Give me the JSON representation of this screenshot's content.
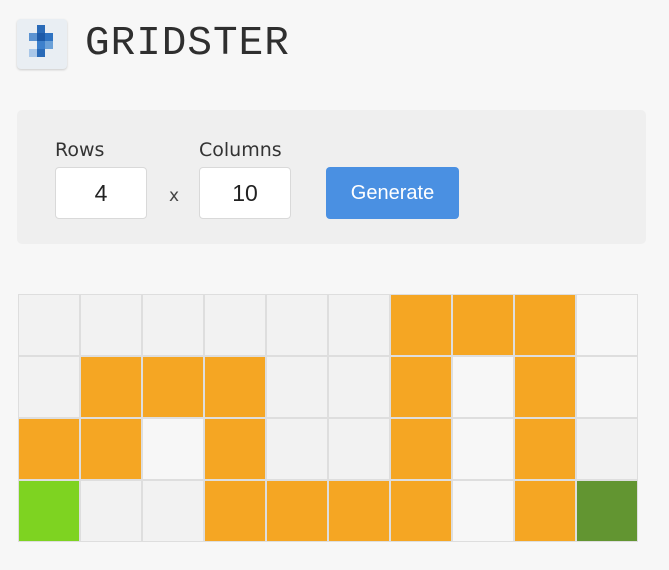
{
  "app": {
    "title": "GRIDSTER",
    "logo_icon": "tetromino-blocks-icon"
  },
  "controls": {
    "rows_label": "Rows",
    "rows_value": "4",
    "times_symbol": "x",
    "columns_label": "Columns",
    "columns_value": "10",
    "generate_label": "Generate"
  },
  "colors": {
    "empty": "#f2f2f2",
    "orange": "#f5a623",
    "start_green": "#7ed321",
    "end_green": "#629531",
    "accent_blue": "#4a90e2",
    "empty_alt": "#f7f7f7"
  },
  "grid": {
    "rows": 4,
    "columns": 10,
    "cells": [
      [
        "empty",
        "empty",
        "empty",
        "empty",
        "empty",
        "empty",
        "orange",
        "orange",
        "orange",
        "empty_alt"
      ],
      [
        "empty",
        "orange",
        "orange",
        "orange",
        "empty",
        "empty",
        "orange",
        "empty_alt",
        "orange",
        "empty_alt"
      ],
      [
        "orange",
        "orange",
        "empty_alt",
        "orange",
        "empty",
        "empty",
        "orange",
        "empty_alt",
        "orange",
        "empty"
      ],
      [
        "start_green",
        "empty",
        "empty",
        "orange",
        "orange",
        "orange",
        "orange",
        "empty_alt",
        "orange",
        "end_green"
      ]
    ]
  }
}
